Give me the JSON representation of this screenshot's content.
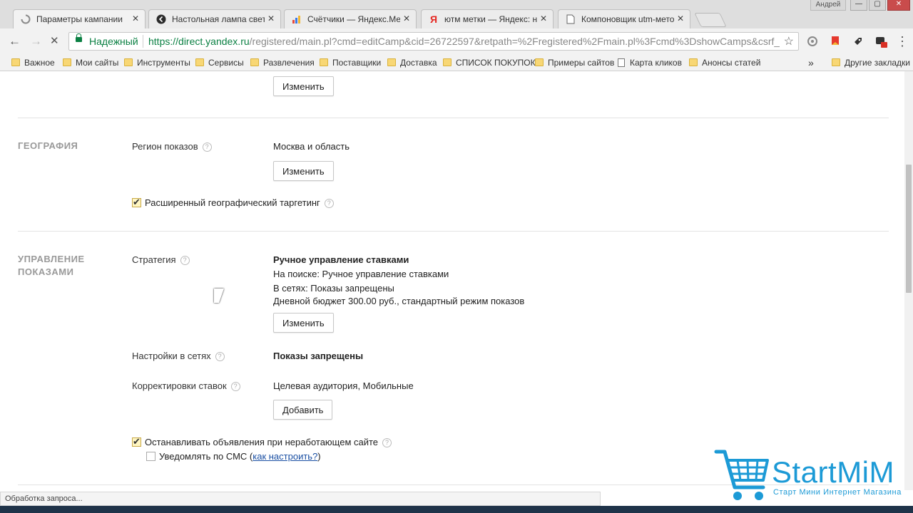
{
  "window": {
    "user": "Андрей",
    "controls": {
      "minimize": "—",
      "maximize": "▢",
      "close": "✕"
    }
  },
  "tabs": [
    {
      "title": "Параметры кампании",
      "icon": "loading-spinner-icon",
      "active": true
    },
    {
      "title": "Настольная лампа светод",
      "icon": "site-favicon-icon"
    },
    {
      "title": "Счётчики — Яндекс.Метр",
      "icon": "metrika-icon"
    },
    {
      "title": "ютм метки — Яндекс: нац",
      "icon": "yandex-icon"
    },
    {
      "title": "Компоновщик utm-меток",
      "icon": "page-icon"
    }
  ],
  "toolbar": {
    "back": "←",
    "forward": "→",
    "stop": "✕",
    "secure_label": "Надежный",
    "url_scheme": "https://",
    "url_host": "direct.yandex.ru",
    "url_rest": "/registered/main.pl?cmd=editCamp&cid=26722597&retpath=%2Fregistered%2Fmain.pl%3Fcmd%3DshowCamps&csrf_",
    "star": "☆"
  },
  "bookmarks": [
    {
      "label": "Важное",
      "type": "folder"
    },
    {
      "label": "Мои сайты",
      "type": "folder"
    },
    {
      "label": "Инструменты",
      "type": "folder"
    },
    {
      "label": "Сервисы",
      "type": "folder"
    },
    {
      "label": "Развлечения",
      "type": "folder"
    },
    {
      "label": "Поставщики",
      "type": "folder"
    },
    {
      "label": "Доставка",
      "type": "folder"
    },
    {
      "label": "СПИСОК ПОКУПОК",
      "type": "folder"
    },
    {
      "label": "Примеры сайтов",
      "type": "folder"
    },
    {
      "label": "Карта кликов",
      "type": "page"
    },
    {
      "label": "Анонсы статей",
      "type": "folder"
    }
  ],
  "bookmarks_more": "»",
  "bookmarks_other": "Другие закладки",
  "content": {
    "top_change_button": "Изменить",
    "geography": {
      "heading": "ГЕОГРАФИЯ",
      "region_label": "Регион показов",
      "region_value": "Москва и область",
      "change_button": "Изменить",
      "extended_targeting": {
        "label": "Расширенный географический таргетинг",
        "checked": true
      }
    },
    "display": {
      "heading_line1": "УПРАВЛЕНИЕ",
      "heading_line2": "ПОКАЗАМИ",
      "strategy_label": "Стратегия",
      "strategy_title": "Ручное управление ставками",
      "strategy_search": "На поиске: Ручное управление ставками",
      "strategy_networks": "В сетях: Показы запрещены",
      "strategy_budget": "Дневной бюджет 300.00 руб., стандартный режим показов",
      "strategy_change_button": "Изменить",
      "network_label": "Настройки в сетях",
      "network_value": "Показы запрещены",
      "bid_label": "Корректировки ставок",
      "bid_value": "Целевая аудитория, Мобильные",
      "bid_add_button": "Добавить",
      "stop_ads": {
        "label": "Останавливать объявления при неработающем сайте",
        "checked": true
      },
      "sms": {
        "label": "Уведомлять по СМС",
        "link": "как настроить?",
        "checked": false
      }
    }
  },
  "help_glyph": "?",
  "status_text": "Обработка запроса...",
  "watermark": {
    "brand": "StartMiM",
    "tagline": "Старт Мини Интернет Магазина",
    "color": "#1c9ad6"
  },
  "colors": {
    "secure_green": "#0b8043",
    "link_blue": "#1a4fa3",
    "section_gray": "#999999"
  }
}
